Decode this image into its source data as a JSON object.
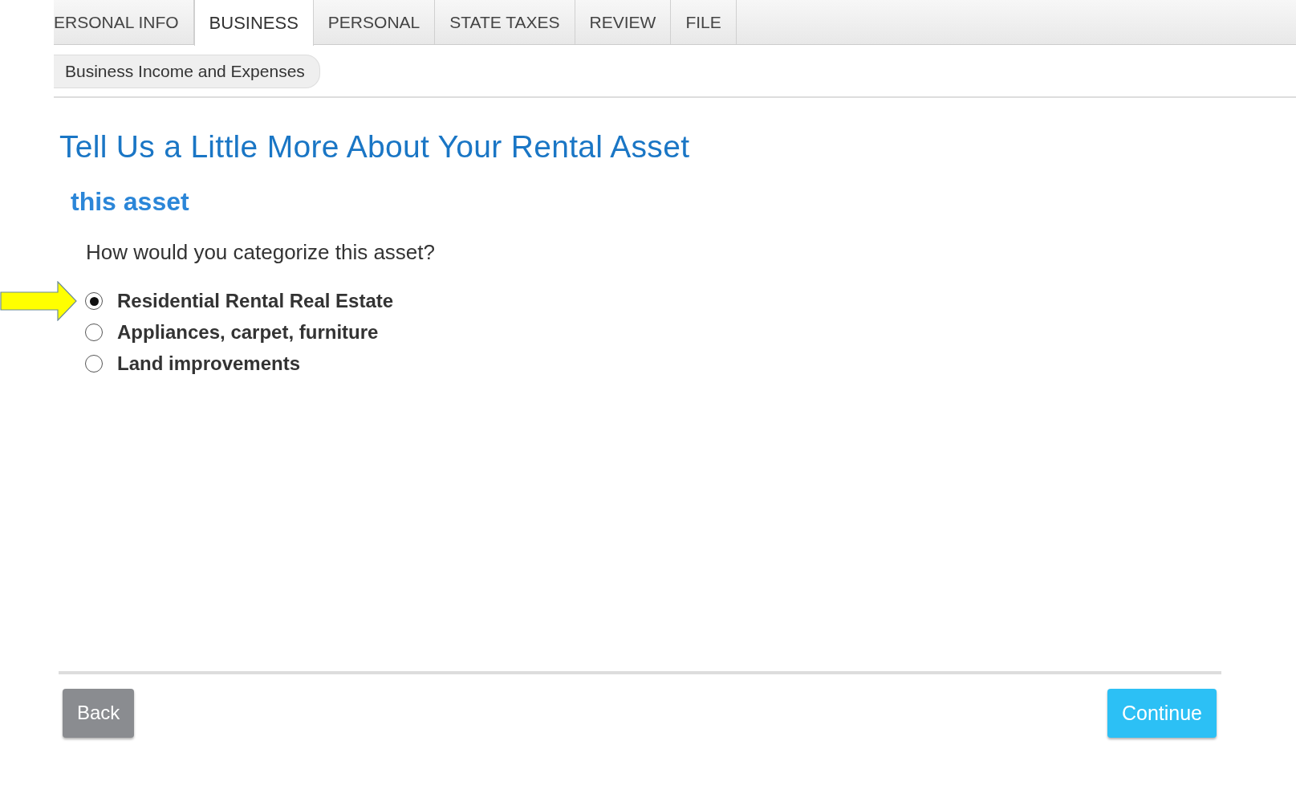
{
  "tabs": [
    {
      "label": "ERSONAL INFO",
      "selected": false
    },
    {
      "label": "BUSINESS",
      "selected": true
    },
    {
      "label": "PERSONAL",
      "selected": false
    },
    {
      "label": "STATE TAXES",
      "selected": false
    },
    {
      "label": "REVIEW",
      "selected": false
    },
    {
      "label": "FILE",
      "selected": false
    }
  ],
  "breadcrumb": "Business Income and Expenses",
  "title": "Tell Us a Little More About Your Rental Asset",
  "subtitle": "this asset",
  "question": "How would you categorize this asset?",
  "options": [
    {
      "label": "Residential Rental Real Estate",
      "selected": true
    },
    {
      "label": "Appliances, carpet, furniture",
      "selected": false
    },
    {
      "label": "Land improvements",
      "selected": false
    }
  ],
  "buttons": {
    "back": "Back",
    "continue": "Continue"
  }
}
